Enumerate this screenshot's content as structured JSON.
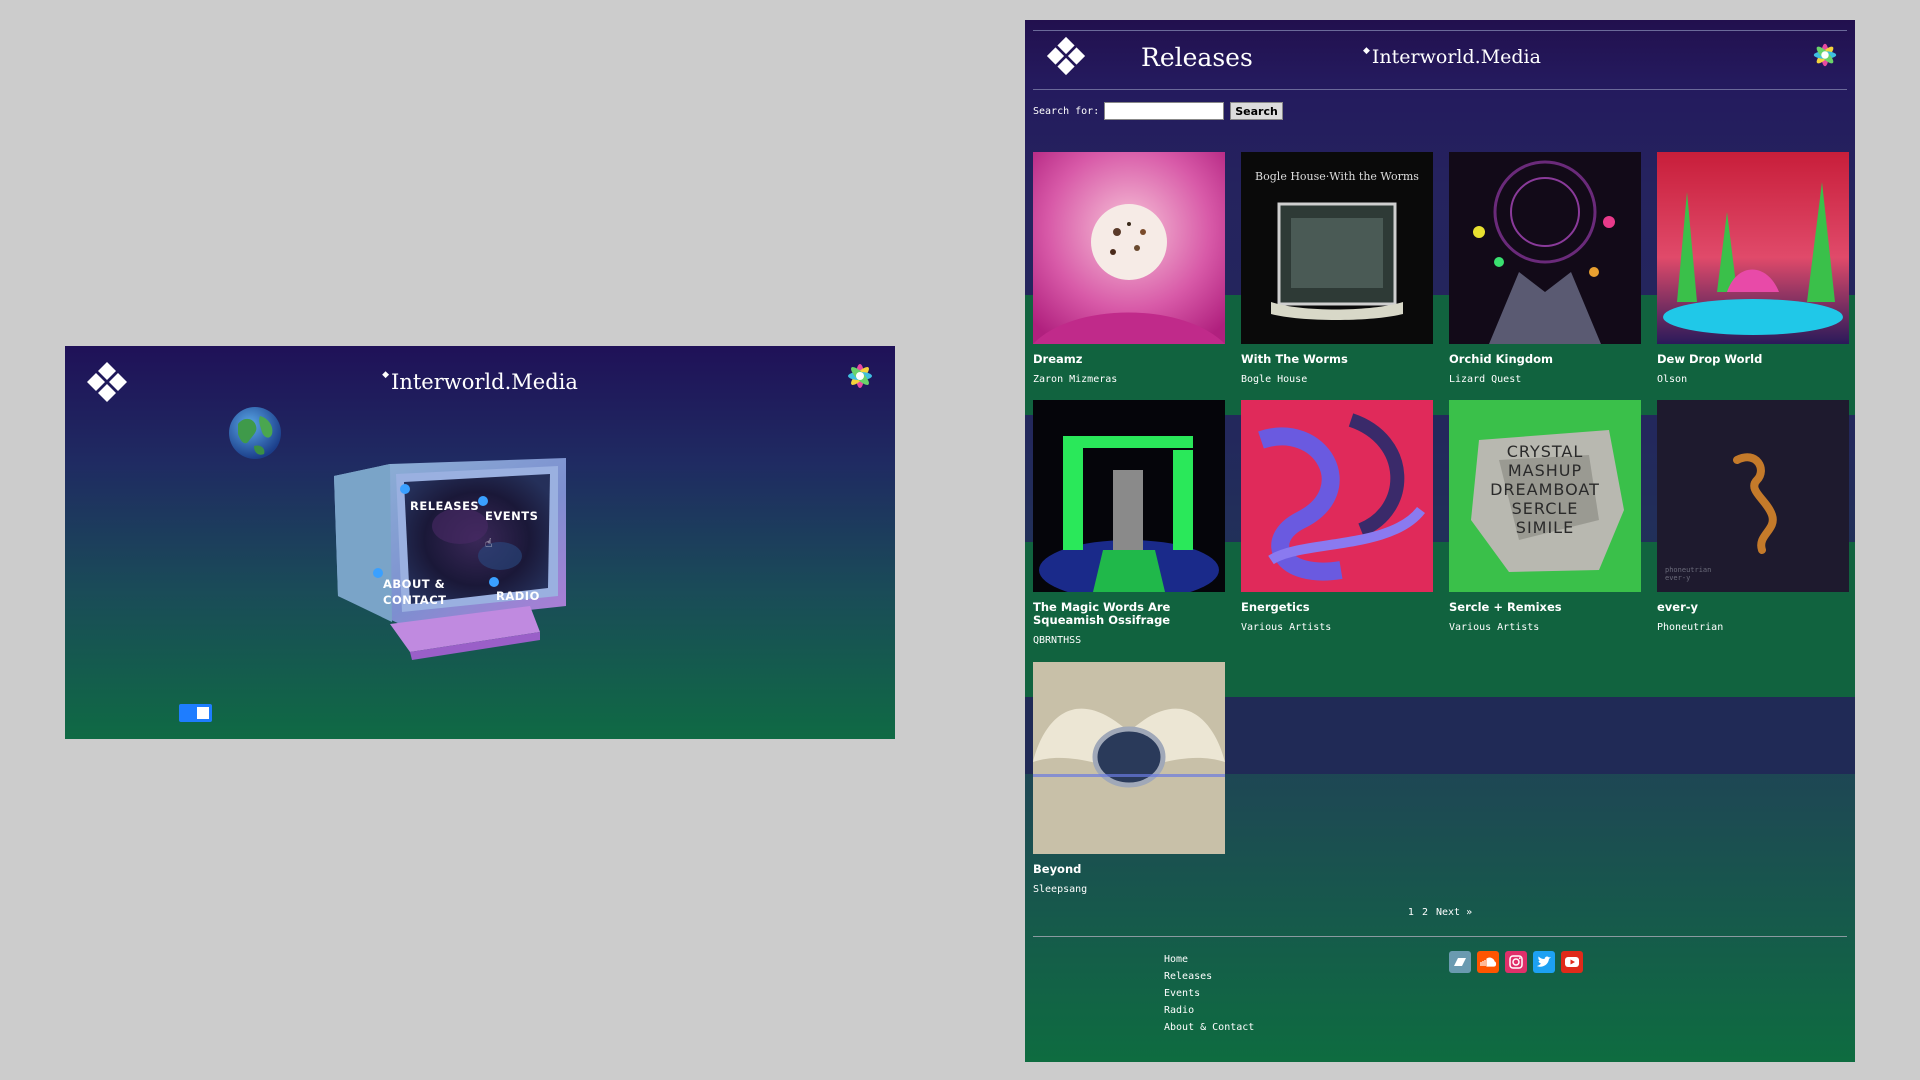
{
  "home": {
    "brand": "Interworld.Media",
    "menu": {
      "releases": "RELEASES",
      "events": "EVENTS",
      "about_line1": "ABOUT &",
      "about_line2": "CONTACT",
      "radio": "RADIO"
    },
    "colors": {
      "accent": "#1e7dff",
      "bg_top": "#1f1158",
      "bg_bottom": "#0f6a44"
    }
  },
  "releases_page": {
    "title": "Releases",
    "brand": "Interworld.Media",
    "search": {
      "label": "Search for:",
      "value": "",
      "button": "Search"
    },
    "releases": [
      {
        "title": "Dreamz",
        "artist": "Zaron Mizmeras"
      },
      {
        "title": "With The Worms",
        "artist": "Bogle House"
      },
      {
        "title": "Orchid Kingdom",
        "artist": "Lizard Quest"
      },
      {
        "title": "Dew Drop World",
        "artist": "Olson"
      },
      {
        "title": "The Magic Words Are Squeamish Ossifrage",
        "artist": "QBRNTHSS"
      },
      {
        "title": "Energetics",
        "artist": "Various Artists"
      },
      {
        "title": "Sercle + Remixes",
        "artist": "Various Artists"
      },
      {
        "title": "ever-y",
        "artist": "Phoneutrian"
      },
      {
        "title": "Beyond",
        "artist": "Sleepsang"
      }
    ],
    "cover_text": {
      "with_the_worms": "Bogle House·With the Worms",
      "sercle": [
        "CRYSTAL",
        "MASHUP",
        "DREAMBOAT",
        "SERCLE",
        "SIMILE"
      ],
      "ever_y": [
        "phoneutrian",
        "ever-y"
      ]
    },
    "pagination": {
      "page1": "1",
      "page2": "2",
      "next": "Next »"
    },
    "footer": {
      "links": [
        "Home",
        "Releases",
        "Events",
        "Radio",
        "About & Contact"
      ],
      "social_icons": [
        "bandcamp-icon",
        "soundcloud-icon",
        "instagram-icon",
        "twitter-icon",
        "youtube-icon"
      ]
    }
  }
}
